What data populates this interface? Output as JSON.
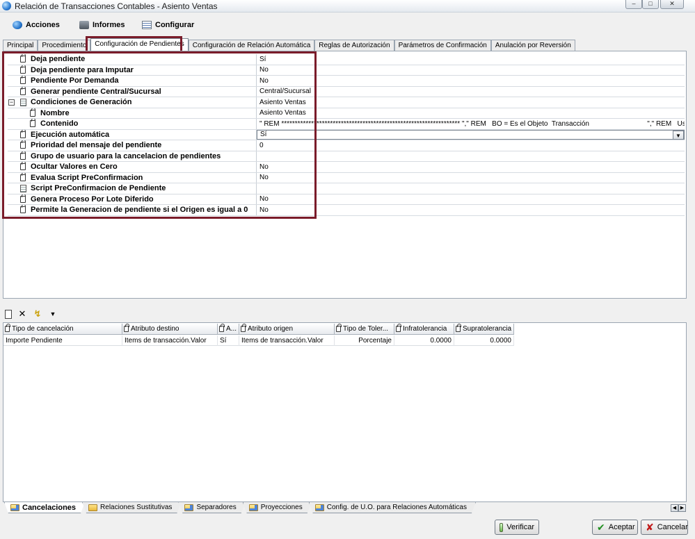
{
  "window": {
    "title": "Relación de Transacciones Contables - Asiento Ventas"
  },
  "toolbar": [
    {
      "label": "Acciones",
      "icon": "acciones-icon"
    },
    {
      "label": "Informes",
      "icon": "printer-icon"
    },
    {
      "label": "Configurar",
      "icon": "configurar-icon"
    }
  ],
  "tabs": [
    "Principal",
    "Procedimiento",
    "Configuración de Pendientes",
    "Configuración de Relación Automática",
    "Reglas de Autorización",
    "Parámetros de Confirmación",
    "Anulación por Reversión"
  ],
  "properties": [
    {
      "name": "Deja pendiente",
      "value": "Sí"
    },
    {
      "name": "Deja pendiente para Imputar",
      "value": "No"
    },
    {
      "name": "Pendiente Por Demanda",
      "value": "No"
    },
    {
      "name": "Generar pendiente Central/Sucursal",
      "value": "Central/Sucursal"
    },
    {
      "name": "Condiciones de Generación",
      "value": "Asiento Ventas"
    },
    {
      "name": "Nombre",
      "value": "Asiento Ventas"
    },
    {
      "name": "Contenido",
      "value": "\" REM ****************************************************************** \",\" REM   BO = Es el Objeto  Transacción                              \",\" REM   UserB..."
    },
    {
      "name": "Ejecución automática",
      "value": "Sí"
    },
    {
      "name": "Prioridad del mensaje del pendiente",
      "value": "0"
    },
    {
      "name": "Grupo de usuario para la cancelacion de pendientes",
      "value": ""
    },
    {
      "name": "Ocultar Valores en Cero",
      "value": "No"
    },
    {
      "name": "Evalua Script PreConfirmacion",
      "value": "No"
    },
    {
      "name": "Script PreConfirmacion de Pendiente",
      "value": ""
    },
    {
      "name": "Genera Proceso Por Lote Diferido",
      "value": "No"
    },
    {
      "name": "Permite la Generacion de pendiente si el Origen es igual a 0",
      "value": "No"
    }
  ],
  "table": {
    "columns": [
      "Tipo de cancelación",
      "Atributo destino",
      "A...",
      "Atributo origen",
      "Tipo de Toler...",
      "Infratolerancia",
      "Supratolerancia"
    ],
    "rows": [
      [
        "Importe Pendiente",
        "Items de transacción.Valor",
        "Sí",
        "Items de transacción.Valor",
        "Porcentaje",
        "0.0000",
        "0.0000"
      ]
    ]
  },
  "bottom_tabs": [
    "Cancelaciones",
    "Relaciones Sustitutivas",
    "Separadores",
    "Proyecciones",
    "Config. de U.O. para Relaciones Automáticas"
  ],
  "buttons": {
    "verify": "Verificar",
    "accept": "Aceptar",
    "cancel": "Cancelar"
  },
  "colors": {
    "highlight": "#7a1c2a"
  }
}
